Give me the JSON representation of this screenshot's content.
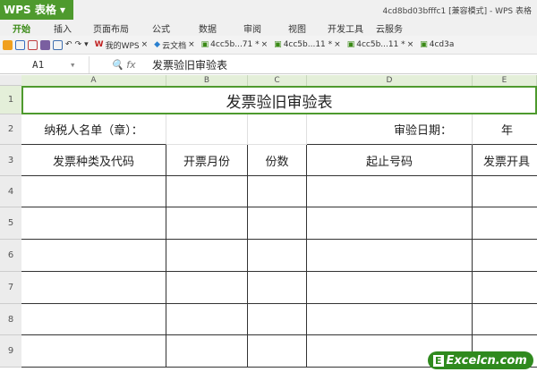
{
  "app": {
    "button": "WPS 表格",
    "title": "4cd8bd03bfffc1 [兼容模式] - WPS 表格"
  },
  "menu": [
    "开始",
    "插入",
    "页面布局",
    "公式",
    "数据",
    "审阅",
    "视图",
    "开发工具",
    "云服务"
  ],
  "tabs": [
    "我的WPS",
    "云文档",
    "4cc5b...71 *",
    "4cc5b...11 *",
    "4cc5b...11 *",
    "4cd3a"
  ],
  "formula": {
    "cell": "A1",
    "fx": "fx",
    "value": "发票验旧审验表"
  },
  "columns": [
    "A",
    "B",
    "C",
    "D",
    "E"
  ],
  "rows": [
    "1",
    "2",
    "3",
    "4",
    "5",
    "6",
    "7",
    "8",
    "9"
  ],
  "sheet": {
    "title": "发票验旧审验表",
    "taxpayer": "纳税人名单（章）：",
    "date_label": "审验日期：",
    "year": "年",
    "headers": [
      "发票种类及代码",
      "开票月份",
      "份数",
      "起止号码",
      "发票开具"
    ]
  },
  "watermark": "Excelcn.com"
}
